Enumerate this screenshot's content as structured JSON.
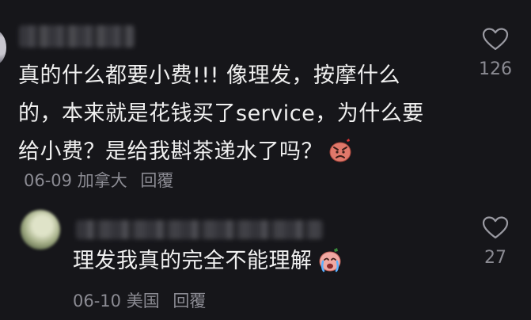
{
  "comment1": {
    "username": "",
    "lines": [
      "真的什么都要小费!!! 像理发，按摩什么",
      "的，本来就是花钱买了service，为什么要",
      "给小费？是给我斟茶递水了吗？"
    ],
    "emoji": "angry-face-emoji",
    "date": "06-09",
    "location": "加拿大",
    "reply_label": "回覆",
    "like_icon": "heart-outline-icon",
    "like_count": "126"
  },
  "comment2": {
    "username": "",
    "text": "理发我真的完全不能理解",
    "emoji": "crying-face-emoji",
    "date": "06-10",
    "location": "美国",
    "reply_label": "回覆",
    "like_icon": "heart-outline-icon",
    "like_count": "27"
  },
  "colors": {
    "background": "#16161a",
    "text_primary": "#f0f0f0",
    "text_secondary": "#8b8b93"
  }
}
